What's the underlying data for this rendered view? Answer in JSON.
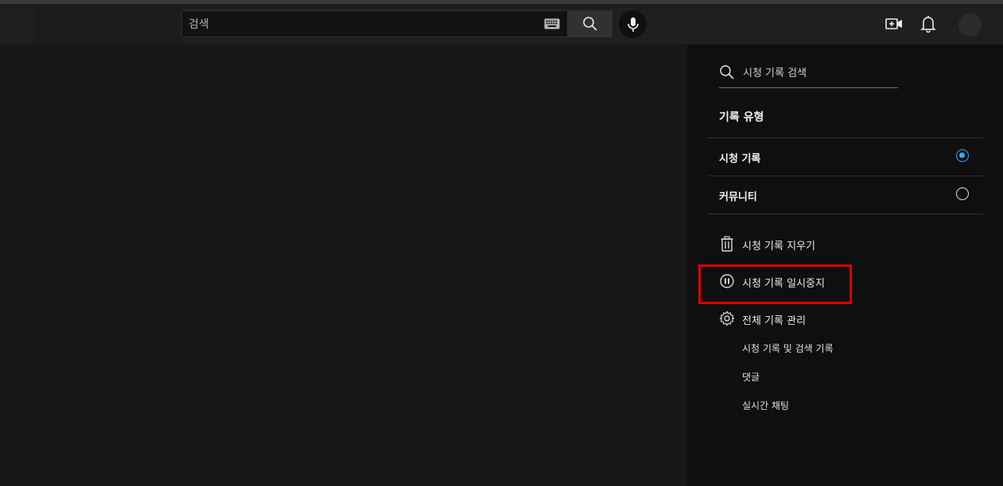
{
  "header": {
    "search_placeholder": "검색",
    "icons": [
      "keyboard-icon",
      "search-icon",
      "mic-icon",
      "create-video-icon",
      "bell-icon",
      "avatar"
    ]
  },
  "sidebar": {
    "search_placeholder": "시청 기록 검색",
    "section_title": "기록 유형",
    "history_types": [
      {
        "label": "시청 기록",
        "selected": true
      },
      {
        "label": "커뮤니티",
        "selected": false
      }
    ],
    "actions": [
      {
        "label": "시청 기록 지우기",
        "icon": "trash-icon"
      },
      {
        "label": "시청 기록 일시중지",
        "icon": "pause-circle-icon"
      },
      {
        "label": "전체 기록 관리",
        "icon": "gear-icon"
      }
    ],
    "sublinks": [
      "시청 기록 및 검색 기록",
      "댓글",
      "실시간 채팅"
    ]
  },
  "colors": {
    "accent": "#3ea6ff",
    "highlight": "#e00000",
    "background": "#181818",
    "sidebar_bg": "#0f0f0f"
  }
}
